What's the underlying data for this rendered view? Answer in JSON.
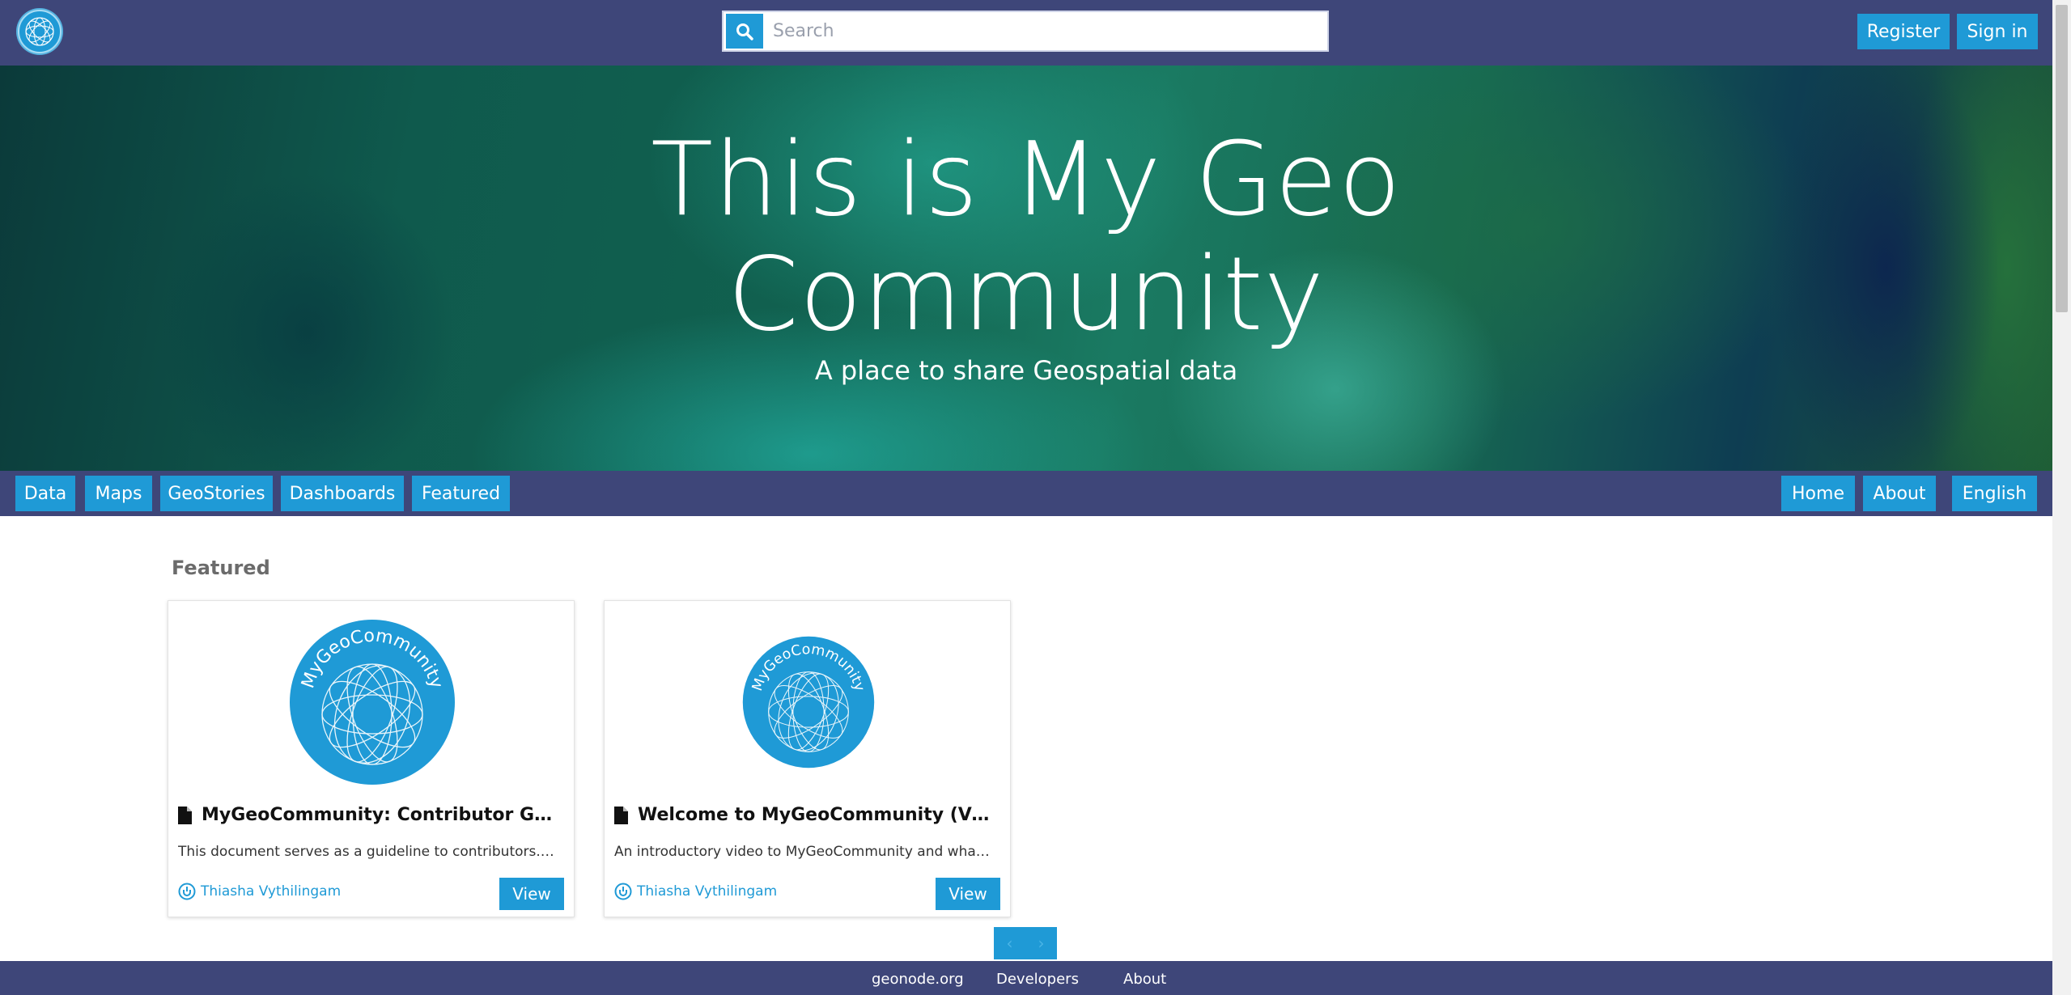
{
  "header": {
    "search_placeholder": "Search",
    "register_label": "Register",
    "signin_label": "Sign in"
  },
  "hero": {
    "title_line1": "This is My Geo",
    "title_line2": "Community",
    "subtitle": "A place to share Geospatial data"
  },
  "nav": {
    "left": [
      "Data",
      "Maps",
      "GeoStories",
      "Dashboards",
      "Featured"
    ],
    "right": [
      "Home",
      "About",
      "English"
    ]
  },
  "featured": {
    "heading": "Featured",
    "cards": [
      {
        "title": "MyGeoCommunity: Contributor Guidelines",
        "description": "This document serves as a guideline to contributors. To ensure quality data",
        "author": "Thiasha Vythilingam",
        "view_label": "View",
        "logo_text": "MyGeoCommunity"
      },
      {
        "title": "Welcome to MyGeoCommunity (Video)",
        "description": "An introductory video to MyGeoCommunity and what it offers",
        "author": "Thiasha Vythilingam",
        "view_label": "View",
        "logo_text": "MyGeoCommunity"
      }
    ]
  },
  "pager": {
    "prev_icon": "chevron-left-icon",
    "next_icon": "chevron-right-icon"
  },
  "footer": {
    "links": [
      "geonode.org",
      "Developers",
      "About"
    ]
  },
  "colors": {
    "navy": "#3e4679",
    "accent": "#1f9ad6"
  }
}
